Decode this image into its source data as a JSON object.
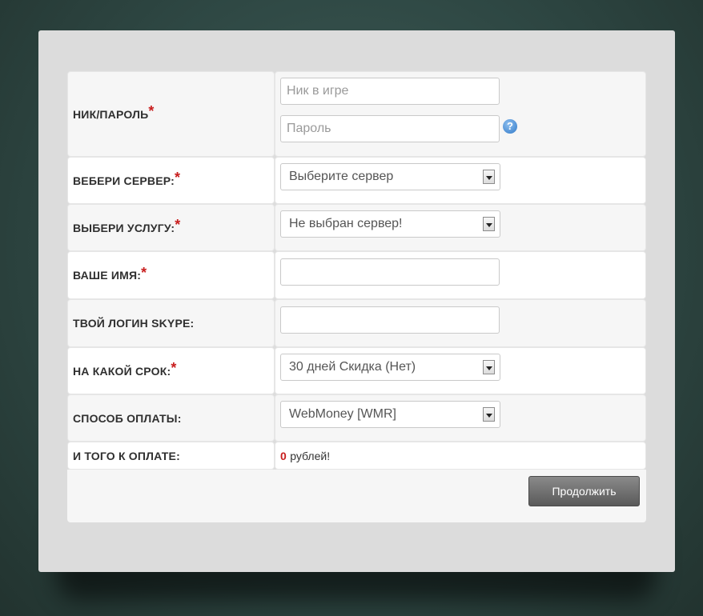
{
  "form": {
    "login": {
      "label": "НИК/ПАРОЛЬ",
      "nick_placeholder": "Ник в игре",
      "password_placeholder": "Пароль",
      "help_icon": "question-icon"
    },
    "server": {
      "label": "ВЕБЕРИ СЕРВЕР:",
      "value": "Выберите сервер"
    },
    "service": {
      "label": "ВЫБЕРИ УСЛУГУ:",
      "value": "Не выбран сервер!"
    },
    "name": {
      "label": "ВАШЕ ИМЯ:",
      "value": ""
    },
    "skype": {
      "label": "ТВОЙ ЛОГИН SKYPE:",
      "value": ""
    },
    "term": {
      "label": "НА КАКОЙ СРОК:",
      "value": "30 дней Скидка (Нет)"
    },
    "payment": {
      "label": "СПОСОБ ОПЛАТЫ:",
      "value": "WebMoney [WMR]"
    },
    "total": {
      "label": "И ТОГО К ОПЛАТЕ:",
      "amount": "0",
      "currency": "рублей!"
    },
    "required_mark": "*",
    "submit_label": "Продолжить"
  },
  "colors": {
    "required": "#c81e1e",
    "button": "#6e6e6e",
    "background": "#2e4743"
  }
}
